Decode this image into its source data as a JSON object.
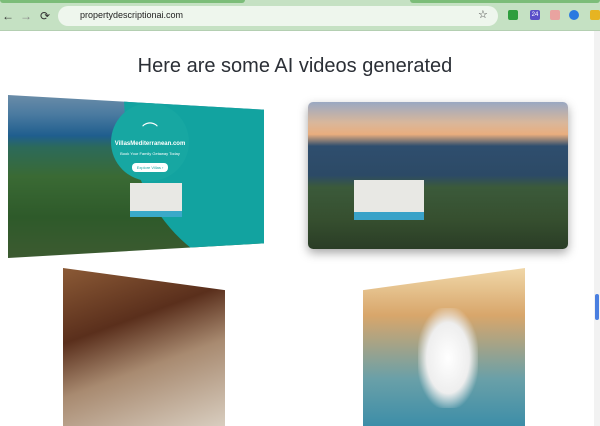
{
  "browser": {
    "url": "propertydescriptionai.com",
    "back": "←",
    "forward": "→",
    "reload": "⟳",
    "bookmark": "☆",
    "extension_badge": "24"
  },
  "page": {
    "heading": "Here are some AI videos generated"
  },
  "videos": [
    {
      "brand": "VillasMediterranean.com",
      "tagline": "Book Your Family Getaway Today",
      "cta": "Explore Villas ›"
    },
    {},
    {},
    {}
  ],
  "colors": {
    "toolbar": "#c5e1c3",
    "brand_teal": "#17a7a2",
    "scroll_thumb": "#4a7fe0"
  }
}
